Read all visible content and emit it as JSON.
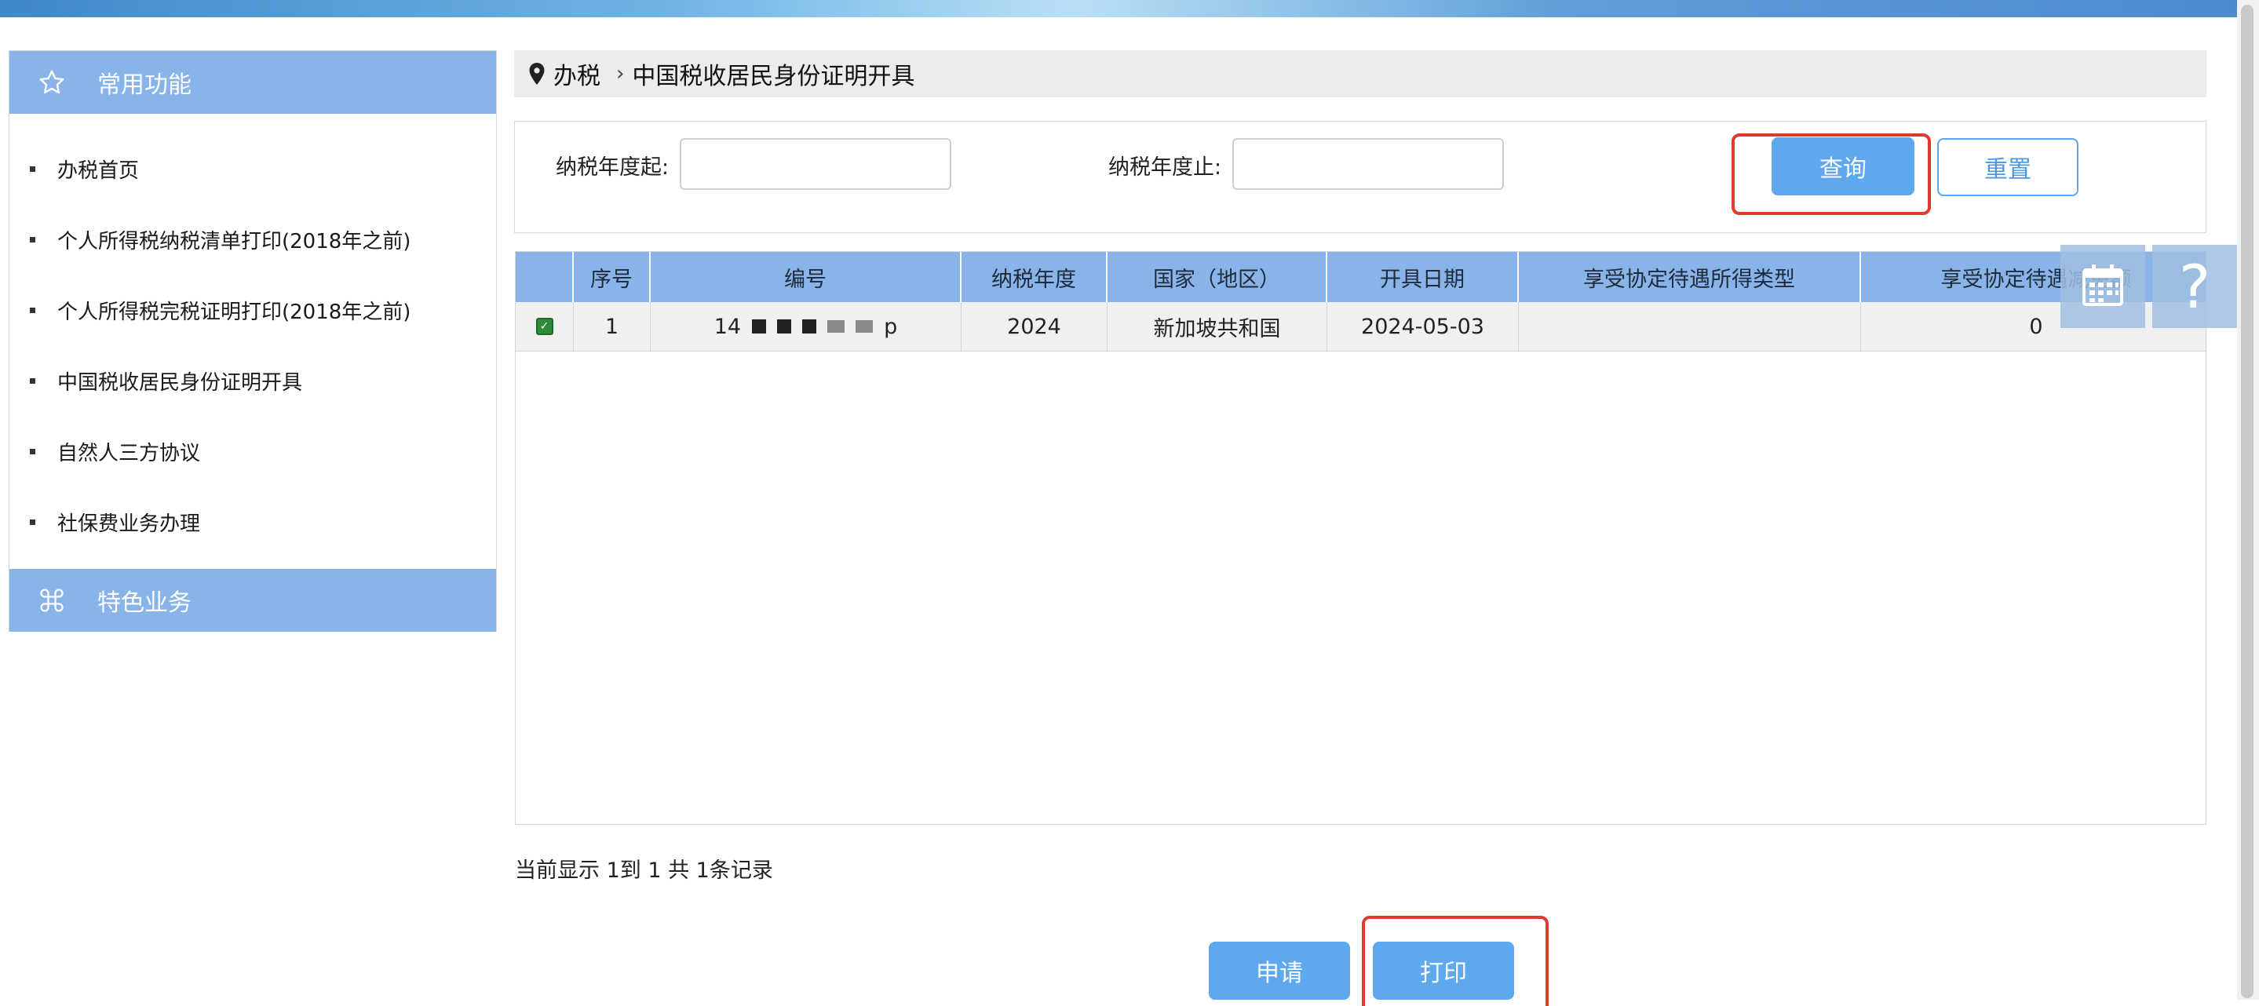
{
  "sidebar": {
    "common_title": "常用功能",
    "items": [
      {
        "label": "办税首页"
      },
      {
        "label": "个人所得税纳税清单打印(2018年之前)"
      },
      {
        "label": "个人所得税完税证明打印(2018年之前)"
      },
      {
        "label": "中国税收居民身份证明开具"
      },
      {
        "label": "自然人三方协议"
      },
      {
        "label": "社保费业务办理"
      }
    ],
    "special_title": "特色业务"
  },
  "breadcrumb": {
    "root": "办税",
    "separator": "›",
    "current": "中国税收居民身份证明开具"
  },
  "search": {
    "year_from_label": "纳税年度起:",
    "year_from_value": "",
    "year_to_label": "纳税年度止:",
    "year_to_value": "",
    "query_button": "查询",
    "reset_button": "重置"
  },
  "table": {
    "columns": [
      "序号",
      "编号",
      "纳税年度",
      "国家（地区）",
      "开具日期",
      "享受协定待遇所得类型",
      "享受协定待遇减免额"
    ],
    "rows": [
      {
        "checked": true,
        "index": "1",
        "number_prefix": "14",
        "number_suffix": "p",
        "tax_year": "2024",
        "country": "新加坡共和国",
        "issue_date": "2024-05-03",
        "income_type": "",
        "relief_amount": "0"
      }
    ]
  },
  "summary": "当前显示 1到 1 共 1条记录",
  "actions": {
    "apply_button": "申请",
    "print_button": "打印"
  },
  "float_tools": {
    "calendar_icon": "calendar-icon",
    "help_symbol": "?"
  },
  "colors": {
    "accent_blue": "#5ea8ee",
    "header_blue": "#88b4ea",
    "highlight_red": "#e03a2e"
  }
}
